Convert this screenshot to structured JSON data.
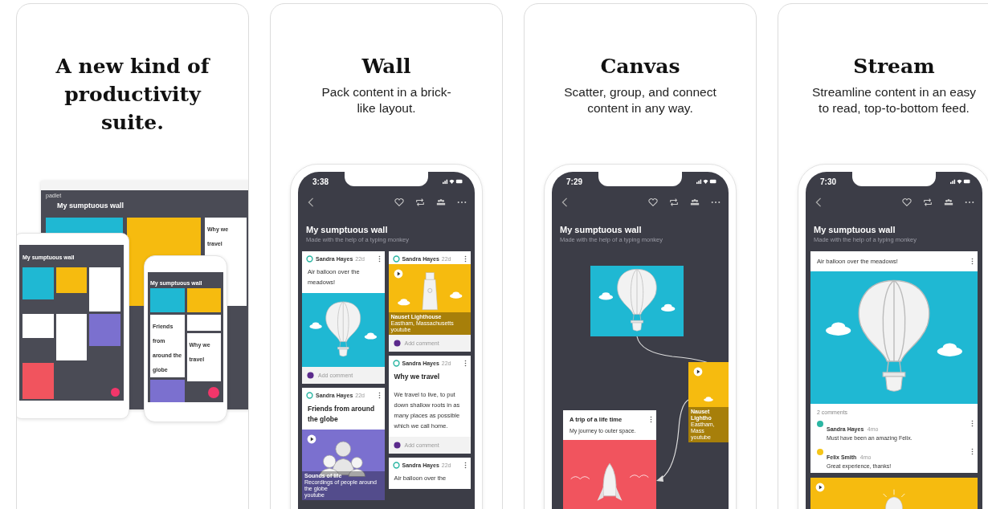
{
  "panels": [
    {
      "kind": "intro",
      "title": "A new kind of productivity suite.",
      "collage": {
        "desktop_logo": "padlet",
        "desktop_title": "My sumptuous wall",
        "desktop_note_title": "Why we travel",
        "tablet_title": "My sumptuous wall",
        "phone_title": "My sumptuous wall",
        "phone_post_title": "Friends from around the globe",
        "phone_note_title": "Why we travel"
      }
    },
    {
      "kind": "wall",
      "title": "Wall",
      "subtitle": "Pack content in a brick-like layout.",
      "phone": {
        "time": "3:38",
        "board_title": "My sumptuous wall",
        "board_subtitle": "Made with the help of a typing monkey",
        "columns": [
          [
            {
              "author": "Sandra Hayes",
              "age": "22d",
              "text": "Air balloon over the meadows!",
              "image": {
                "kind": "balloon"
              },
              "comment_placeholder": "Add comment"
            },
            {
              "author": "Sandra Hayes",
              "age": "22d",
              "title": "Friends from around the globe",
              "image": {
                "kind": "people",
                "play": true,
                "caption_title": "Sounds of life",
                "caption_subtitle": "Recordings of people around the globe",
                "caption_source": "youtube"
              }
            }
          ],
          [
            {
              "author": "Sandra Hayes",
              "age": "22d",
              "image": {
                "kind": "lighthouse",
                "play": true,
                "caption_title": "Nauset Lighthouse",
                "caption_subtitle": "Eastham, Massachusetts",
                "caption_source": "youtube"
              },
              "comment_placeholder": "Add comment"
            },
            {
              "author": "Sandra Hayes",
              "age": "22d",
              "title": "Why we travel",
              "text": "We travel to live, to put down shallow roots in as many places as possible which we call home.",
              "comment_placeholder": "Add comment"
            },
            {
              "author": "Sandra Hayes",
              "age": "22d",
              "text": "Air balloon over the"
            }
          ]
        ]
      }
    },
    {
      "kind": "canvas",
      "title": "Canvas",
      "subtitle": "Scatter, group, and connect content in any way.",
      "phone": {
        "time": "7:29",
        "board_title": "My sumptuous wall",
        "board_subtitle": "Made with the help of a typing monkey",
        "items": [
          {
            "kind": "image",
            "image": {
              "kind": "balloon"
            }
          },
          {
            "kind": "note",
            "title": "A trip of a life time",
            "text": "My journey to outer space.",
            "image": {
              "kind": "rocket"
            }
          },
          {
            "kind": "media",
            "image": {
              "kind": "cloud",
              "play": true,
              "caption_title": "Nauset Lightho",
              "caption_subtitle": "Eastham, Mass",
              "caption_source": "youtube"
            }
          }
        ]
      }
    },
    {
      "kind": "stream",
      "title": "Stream",
      "subtitle": "Streamline content in an easy to read, top-to-bottom feed.",
      "phone": {
        "time": "7:30",
        "board_title": "My sumptuous wall",
        "board_subtitle": "Made with the help of a typing monkey",
        "posts": [
          {
            "text": "Air balloon over the meadows!",
            "image": {
              "kind": "balloon"
            },
            "comments_count": "2 comments",
            "comments": [
              {
                "author": "Sandra Hayes",
                "age": "4mo",
                "text": "Must have been an amazing Felix.",
                "color": "#2bb6a3"
              },
              {
                "author": "Felix Smith",
                "age": "4mo",
                "text": "Great experience, thanks!",
                "color": "#f5c518"
              }
            ]
          },
          {
            "image": {
              "kind": "bulb",
              "play": true
            }
          }
        ]
      }
    }
  ]
}
